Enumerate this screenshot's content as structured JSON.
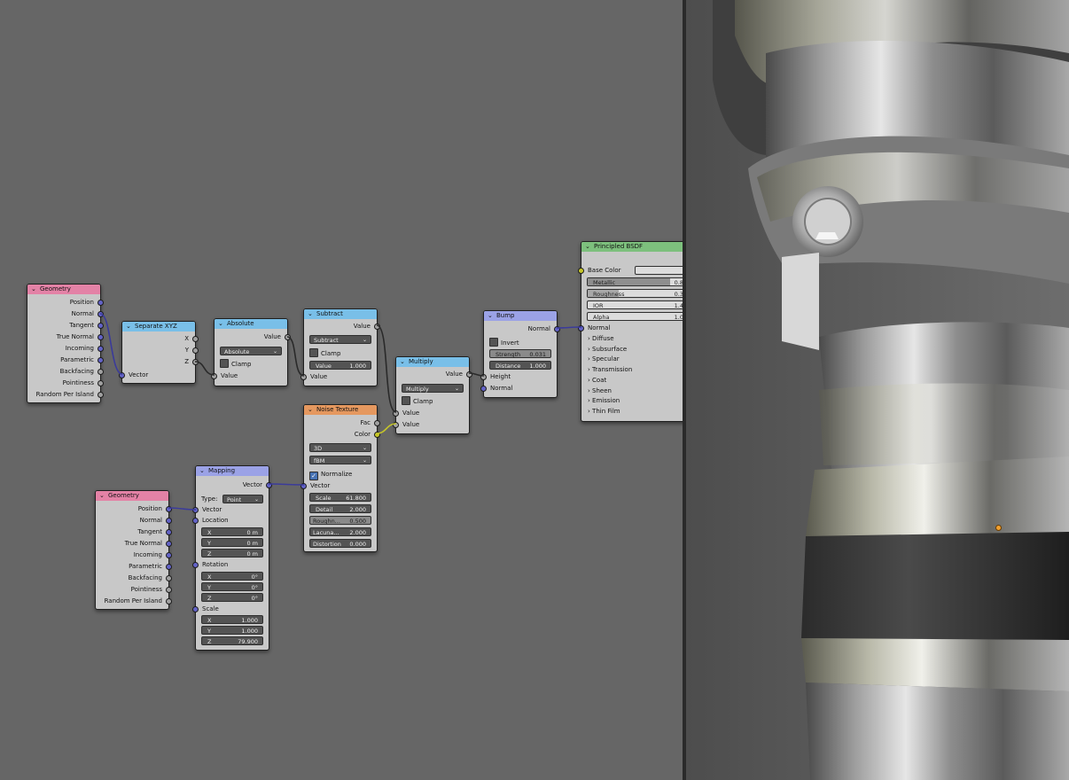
{
  "nodes": {
    "geometry1": {
      "title": "Geometry",
      "outputs": [
        "Position",
        "Normal",
        "Tangent",
        "True Normal",
        "Incoming",
        "Parametric",
        "Backfacing",
        "Pointiness",
        "Random Per Island"
      ]
    },
    "separate_xyz": {
      "title": "Separate XYZ",
      "outputs": [
        "X",
        "Y",
        "Z"
      ],
      "input": "Vector"
    },
    "absolute": {
      "title": "Absolute",
      "output": "Value",
      "operation": "Absolute",
      "clamp_label": "Clamp",
      "input": "Value"
    },
    "subtract": {
      "title": "Subtract",
      "output": "Value",
      "operation": "Subtract",
      "clamp_label": "Clamp",
      "input": "Value",
      "field_label": "Value",
      "field_value": "1.000"
    },
    "multiply": {
      "title": "Multiply",
      "output": "Value",
      "operation": "Multiply",
      "clamp_label": "Clamp",
      "inputs": [
        "Value",
        "Value"
      ]
    },
    "bump": {
      "title": "Bump",
      "output": "Normal",
      "invert_label": "Invert",
      "strength_label": "Strength",
      "strength_value": "0.031",
      "distance_label": "Distance",
      "distance_value": "1.000",
      "inputs": [
        "Height",
        "Normal"
      ]
    },
    "principled": {
      "title": "Principled BSDF",
      "base_color": "Base Color",
      "fields": [
        {
          "label": "Metallic",
          "value": "0.8"
        },
        {
          "label": "Roughness",
          "value": "0.3"
        },
        {
          "label": "IOR",
          "value": "1.4"
        },
        {
          "label": "Alpha",
          "value": "1.0"
        }
      ],
      "normal": "Normal",
      "panels": [
        "Diffuse",
        "Subsurface",
        "Specular",
        "Transmission",
        "Coat",
        "Sheen",
        "Emission",
        "Thin Film"
      ]
    },
    "noise": {
      "title": "Noise Texture",
      "outputs": [
        "Fac",
        "Color"
      ],
      "dimensions": "3D",
      "type": "fBM",
      "normalize_label": "Normalize",
      "vector_label": "Vector",
      "fields": [
        {
          "label": "Scale",
          "value": "61.800"
        },
        {
          "label": "Detail",
          "value": "2.000"
        },
        {
          "label": "Roughn...",
          "value": "0.500"
        },
        {
          "label": "Lacuna...",
          "value": "2.000"
        },
        {
          "label": "Distortion",
          "value": "0.000"
        }
      ]
    },
    "mapping": {
      "title": "Mapping",
      "output": "Vector",
      "type_label": "Type:",
      "type_value": "Point",
      "vector_label": "Vector",
      "location_label": "Location",
      "location": [
        {
          "axis": "X",
          "value": "0 m"
        },
        {
          "axis": "Y",
          "value": "0 m"
        },
        {
          "axis": "Z",
          "value": "0 m"
        }
      ],
      "rotation_label": "Rotation",
      "rotation": [
        {
          "axis": "X",
          "value": "0°"
        },
        {
          "axis": "Y",
          "value": "0°"
        },
        {
          "axis": "Z",
          "value": "0°"
        }
      ],
      "scale_label": "Scale",
      "scale": [
        {
          "axis": "X",
          "value": "1.000"
        },
        {
          "axis": "Y",
          "value": "1.000"
        },
        {
          "axis": "Z",
          "value": "79.900"
        }
      ]
    },
    "geometry2": {
      "title": "Geometry",
      "outputs": [
        "Position",
        "Normal",
        "Tangent",
        "True Normal",
        "Incoming",
        "Parametric",
        "Backfacing",
        "Pointiness",
        "Random Per Island"
      ]
    }
  },
  "colors": {
    "editor_bg": "#666666",
    "node_body": "#c8c8c8",
    "input_header": "#e382a6",
    "vector_header": "#79bfe8",
    "color_header": "#9ba2e6",
    "texture_header": "#e5985f",
    "shader_header": "#7dc07d",
    "vector_socket": "#6363c7",
    "float_socket": "#a1a1a1",
    "color_socket": "#c7c729"
  }
}
